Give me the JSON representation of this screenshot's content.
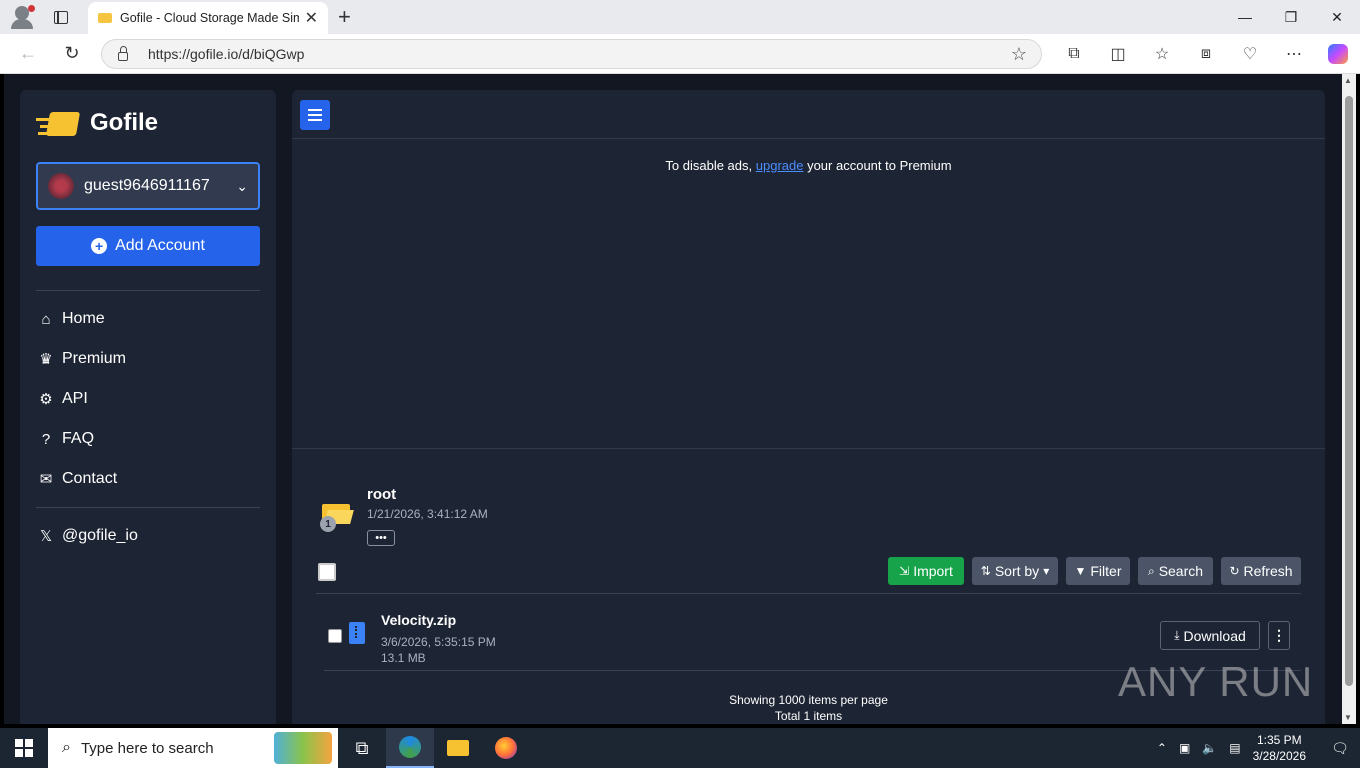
{
  "browser": {
    "tab_title": "Gofile - Cloud Storage Made Simple",
    "url": "https://gofile.io/d/biQGwp"
  },
  "sidebar": {
    "brand": "Gofile",
    "account_name": "guest9646911167",
    "add_account_label": "Add Account",
    "nav": [
      {
        "label": "Home",
        "icon": "home-icon"
      },
      {
        "label": "Premium",
        "icon": "crown-icon"
      },
      {
        "label": "API",
        "icon": "cogs-icon"
      },
      {
        "label": "FAQ",
        "icon": "question-icon"
      },
      {
        "label": "Contact",
        "icon": "envelope-icon"
      }
    ],
    "social": "@gofile_io"
  },
  "ad": {
    "prefix": "To disable ads, ",
    "link": "upgrade",
    "suffix": " your account to Premium"
  },
  "folder": {
    "name": "root",
    "date": "1/21/2026, 3:41:12 AM",
    "badge": "1",
    "more": "•••"
  },
  "actions": {
    "import": "Import",
    "sort": "Sort by",
    "filter": "Filter",
    "search": "Search",
    "refresh": "Refresh"
  },
  "files": [
    {
      "name": "Velocity.zip",
      "date": "3/6/2026, 5:35:15 PM",
      "size": "13.1 MB",
      "download": "Download"
    }
  ],
  "paging": {
    "per_page": "Showing 1000 items per page",
    "total": "Total 1 items"
  },
  "watermark": "ANY RUN",
  "taskbar": {
    "search_placeholder": "Type here to search",
    "time": "1:35 PM",
    "date": "3/28/2026"
  }
}
